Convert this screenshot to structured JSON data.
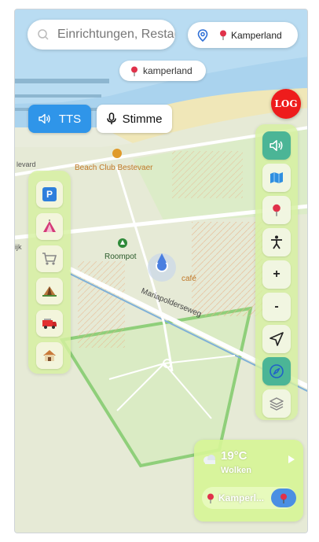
{
  "search": {
    "placeholder": "Einrichtungen, Restaurants"
  },
  "location_pill": {
    "label": "Kamperland"
  },
  "place_chip": {
    "label": "kamperland"
  },
  "log_button": {
    "label": "LOG"
  },
  "tts_button": {
    "label": "TTS"
  },
  "voice_button": {
    "label": "Stimme"
  },
  "map": {
    "labels": {
      "beach_club": "Beach Club Bestevaer",
      "roompot": "Roompot",
      "street": "Mariapolderseweg",
      "cafe": "café",
      "levard": "levard",
      "ijk": "ijk"
    },
    "colors": {
      "water": "#aad3ee",
      "land": "#e9ecdc",
      "road_orange": "#e7a56a",
      "green_border": "#8fcf7a"
    }
  },
  "left_panel": {
    "items": [
      {
        "name": "parking-icon",
        "glyph": "P"
      },
      {
        "name": "tent-icon"
      },
      {
        "name": "shopping-cart-icon"
      },
      {
        "name": "camping-tent-icon"
      },
      {
        "name": "fire-truck-icon"
      },
      {
        "name": "house-icon"
      }
    ]
  },
  "right_panel": {
    "zoom_in": "+",
    "zoom_out": "-"
  },
  "weather": {
    "temperature": "19°C",
    "condition": "Wolken",
    "location": "Kamperl..."
  }
}
